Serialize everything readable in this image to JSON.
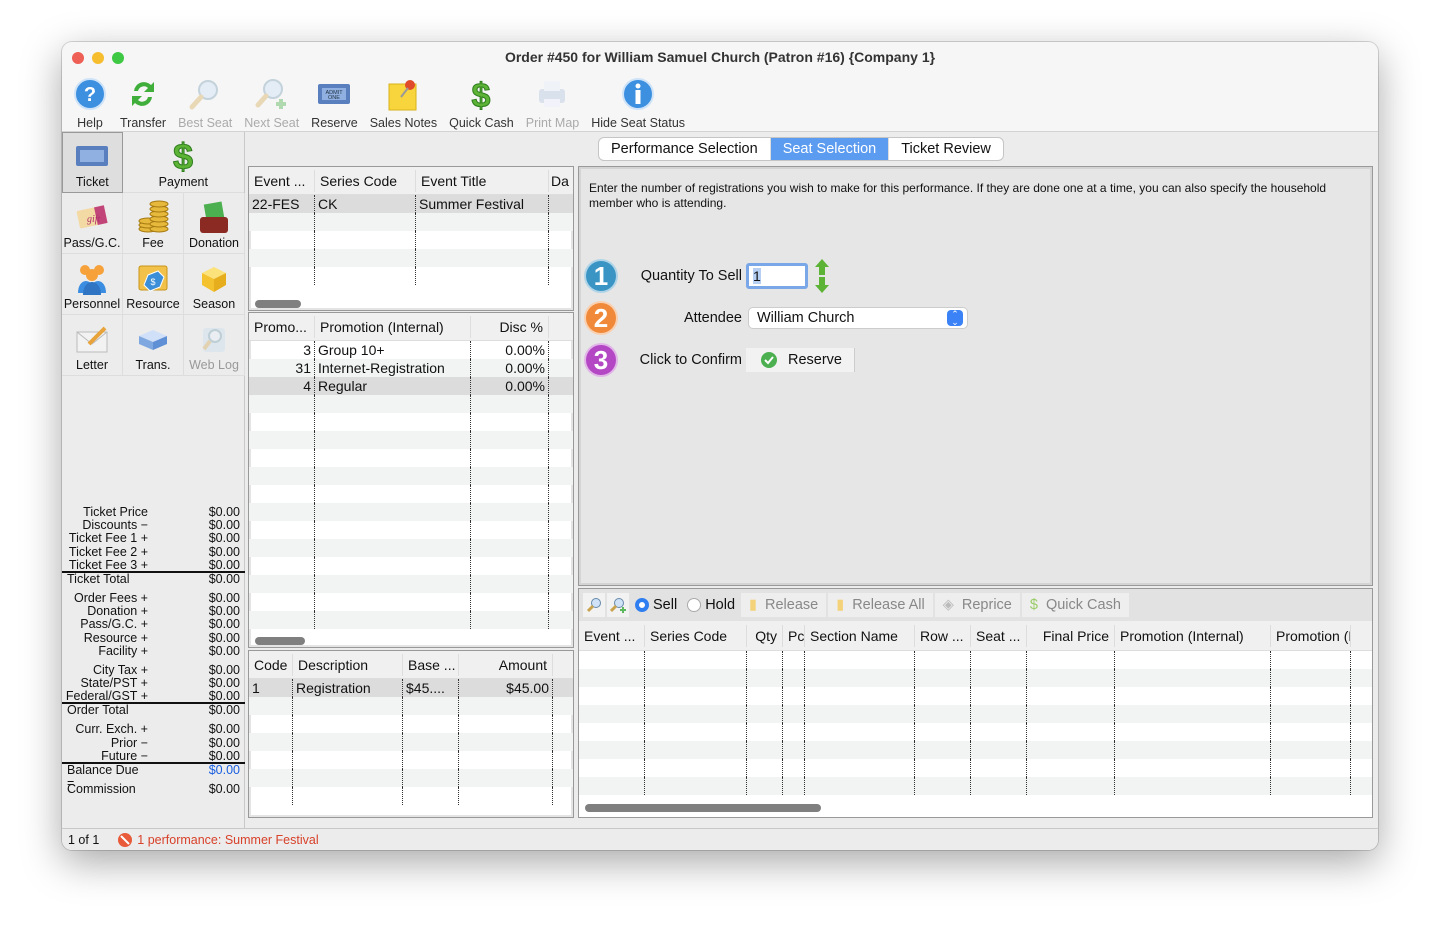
{
  "window": {
    "title": "Order #450 for William Samuel Church (Patron #16) {Company 1}"
  },
  "toolbar": [
    {
      "label": "Help",
      "icon": "help-icon",
      "enabled": true
    },
    {
      "label": "Transfer",
      "icon": "transfer-icon",
      "enabled": true
    },
    {
      "label": "Best Seat",
      "icon": "magnifier-icon",
      "enabled": false
    },
    {
      "label": "Next Seat",
      "icon": "magnifier-plus-icon",
      "enabled": false
    },
    {
      "label": "Reserve",
      "icon": "ticket-icon",
      "enabled": true
    },
    {
      "label": "Sales Notes",
      "icon": "sticky-note-icon",
      "enabled": true
    },
    {
      "label": "Quick Cash",
      "icon": "dollar-icon",
      "enabled": true
    },
    {
      "label": "Print Map",
      "icon": "printer-icon",
      "enabled": false
    },
    {
      "label": "Hide Seat Status",
      "icon": "info-icon",
      "enabled": true
    }
  ],
  "sidebar": {
    "top": [
      {
        "label": "Ticket",
        "icon": "ticket-icon",
        "selected": true
      },
      {
        "label": "Payment",
        "icon": "dollar-icon"
      }
    ],
    "grid": [
      {
        "label": "Pass/G.C.",
        "icon": "gift-card-icon"
      },
      {
        "label": "Fee",
        "icon": "coins-icon"
      },
      {
        "label": "Donation",
        "icon": "money-box-icon"
      },
      {
        "label": "Personnel",
        "icon": "people-icon"
      },
      {
        "label": "Resource",
        "icon": "resource-tag-icon"
      },
      {
        "label": "Season",
        "icon": "box-icon"
      },
      {
        "label": "Letter",
        "icon": "envelope-icon"
      },
      {
        "label": "Trans.",
        "icon": "transaction-icon"
      },
      {
        "label": "Web Log",
        "icon": "web-log-icon",
        "enabled": false
      }
    ],
    "totals": [
      {
        "label": "Ticket Price",
        "value": "$0.00"
      },
      {
        "label": "Discounts −",
        "value": "$0.00"
      },
      {
        "label": "Ticket Fee 1 +",
        "value": "$0.00"
      },
      {
        "label": "Ticket Fee 2 +",
        "value": "$0.00"
      },
      {
        "label": "Ticket Fee 3 +",
        "value": "$0.00",
        "underline": true
      },
      {
        "label": "Ticket Total",
        "value": "$0.00",
        "total": true,
        "gap": true
      },
      {
        "label": "Order Fees +",
        "value": "$0.00"
      },
      {
        "label": "Donation +",
        "value": "$0.00"
      },
      {
        "label": "Pass/G.C. +",
        "value": "$0.00"
      },
      {
        "label": "Resource +",
        "value": "$0.00"
      },
      {
        "label": "Facility +",
        "value": "$0.00",
        "gap": true
      },
      {
        "label": "City Tax +",
        "value": "$0.00"
      },
      {
        "label": "State/PST +",
        "value": "$0.00"
      },
      {
        "label": "Federal/GST +",
        "value": "$0.00",
        "underline": true
      },
      {
        "label": "Order Total",
        "value": "$0.00",
        "total": true,
        "gap": true
      },
      {
        "label": "Curr. Exch. +",
        "value": "$0.00"
      },
      {
        "label": "Prior −",
        "value": "$0.00"
      },
      {
        "label": "Future −",
        "value": "$0.00",
        "underline": true
      },
      {
        "label": "Balance Due =",
        "value": "$0.00",
        "total": true,
        "blue": true,
        "gap": true
      },
      {
        "label": "Commission",
        "value": "$0.00",
        "total": true
      }
    ]
  },
  "events_table": {
    "columns": [
      "Event ...",
      "Series Code",
      "Event Title",
      "Da"
    ],
    "rows": [
      [
        "22-FES",
        "CK",
        "Summer Festival",
        ""
      ]
    ]
  },
  "promo_table": {
    "columns": [
      "Promo...",
      "Promotion (Internal)",
      "Disc %"
    ],
    "rows": [
      [
        "3",
        "Group 10+",
        "0.00%"
      ],
      [
        "31",
        "Internet-Registration",
        "0.00%"
      ],
      [
        "4",
        "Regular",
        "0.00%"
      ]
    ]
  },
  "price_table": {
    "columns": [
      "Code",
      "Description",
      "Base ...",
      "Amount"
    ],
    "rows": [
      [
        "1",
        "Registration",
        "$45....",
        "$45.00"
      ]
    ]
  },
  "tabs": [
    {
      "label": "Performance Selection"
    },
    {
      "label": "Seat Selection",
      "active": true
    },
    {
      "label": "Ticket Review"
    }
  ],
  "seat_selection": {
    "instructions": "Enter the number of registrations you wish to make for this performance.  If they are done one at a time, you can also specify the household member who is attending.",
    "step1": {
      "number": "1",
      "label": "Quantity To Sell",
      "value": "1",
      "color": "#3b95c4"
    },
    "step2": {
      "number": "2",
      "label": "Attendee",
      "value": "William Church",
      "color": "#f08a3a"
    },
    "step3": {
      "number": "3",
      "label": "Click to Confirm",
      "button": "Reserve",
      "color": "#b347c4"
    }
  },
  "cart_toolbar": {
    "sell": "Sell",
    "hold": "Hold",
    "mode": "Sell",
    "release": "Release",
    "release_all": "Release All",
    "reprice": "Reprice",
    "quick_cash": "Quick Cash"
  },
  "cart_table": {
    "columns": [
      "Event ...",
      "Series Code",
      "Qty",
      "Pc",
      "Section Name",
      "Row ...",
      "Seat ...",
      "Final Price",
      "Promotion (Internal)",
      "Promotion (Ex"
    ],
    "rows": []
  },
  "status": {
    "page": "1 of 1",
    "message": "1 performance: Summer Festival"
  }
}
